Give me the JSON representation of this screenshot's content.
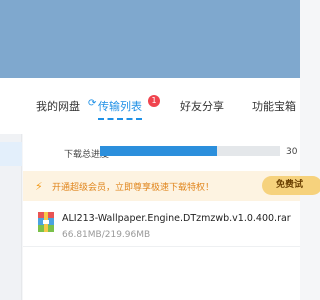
{
  "nav": {
    "tabs": [
      {
        "label": "我的网盘"
      },
      {
        "label": "传输列表",
        "badge": "1"
      },
      {
        "label": "好友分享"
      },
      {
        "label": "功能宝箱"
      }
    ]
  },
  "transfer": {
    "speed_label": "下载总进度",
    "progress_text": "30",
    "progress_fraction": 0.65
  },
  "promo": {
    "text": "开通超级会员，立即尊享极速下载特权！",
    "button_label": "免费试"
  },
  "file": {
    "name": "ALI213-Wallpaper.Engine.DTzmzwb.v1.0.400.rar",
    "size": "66.81MB/219.96MB"
  },
  "colors": {
    "accent": "#1e90e6",
    "badge": "#f0444e",
    "progress": "#2b8fdc",
    "promo_text": "#e0851c"
  }
}
